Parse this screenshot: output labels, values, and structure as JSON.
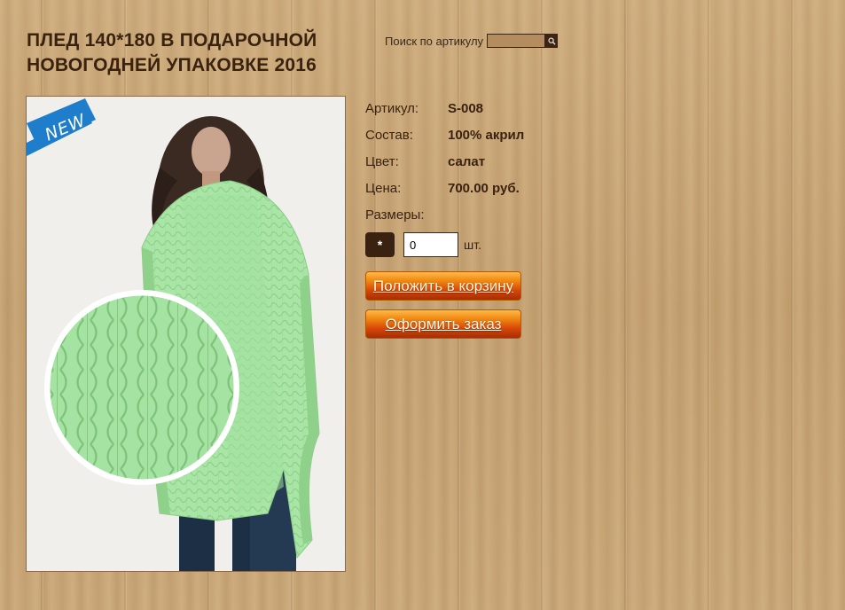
{
  "product": {
    "title": "ПЛЕД 140*180 В ПОДАРОЧНОЙ НОВОГОДНЕЙ УПАКОВКЕ 2016",
    "badge": "NEW",
    "specs": [
      {
        "label": "Артикул:",
        "value": "S-008"
      },
      {
        "label": "Состав:",
        "value": "100% акрил"
      },
      {
        "label": "Цвет:",
        "value": "салат"
      },
      {
        "label": "Цена:",
        "value": "700.00 руб."
      },
      {
        "label": "Размеры:",
        "value": ""
      }
    ],
    "size_option": "*",
    "quantity": "0",
    "unit": "шт."
  },
  "search": {
    "label": "Поиск по артикулу",
    "value": ""
  },
  "buttons": {
    "add_to_cart": "Положить в корзину",
    "checkout": "Оформить заказ"
  },
  "colors": {
    "title": "#3a2210",
    "button_orange": "#f08a12",
    "product_green": "#a8e6a6",
    "badge_blue": "#1f7ecb"
  },
  "icons": {
    "search": "search-icon"
  }
}
